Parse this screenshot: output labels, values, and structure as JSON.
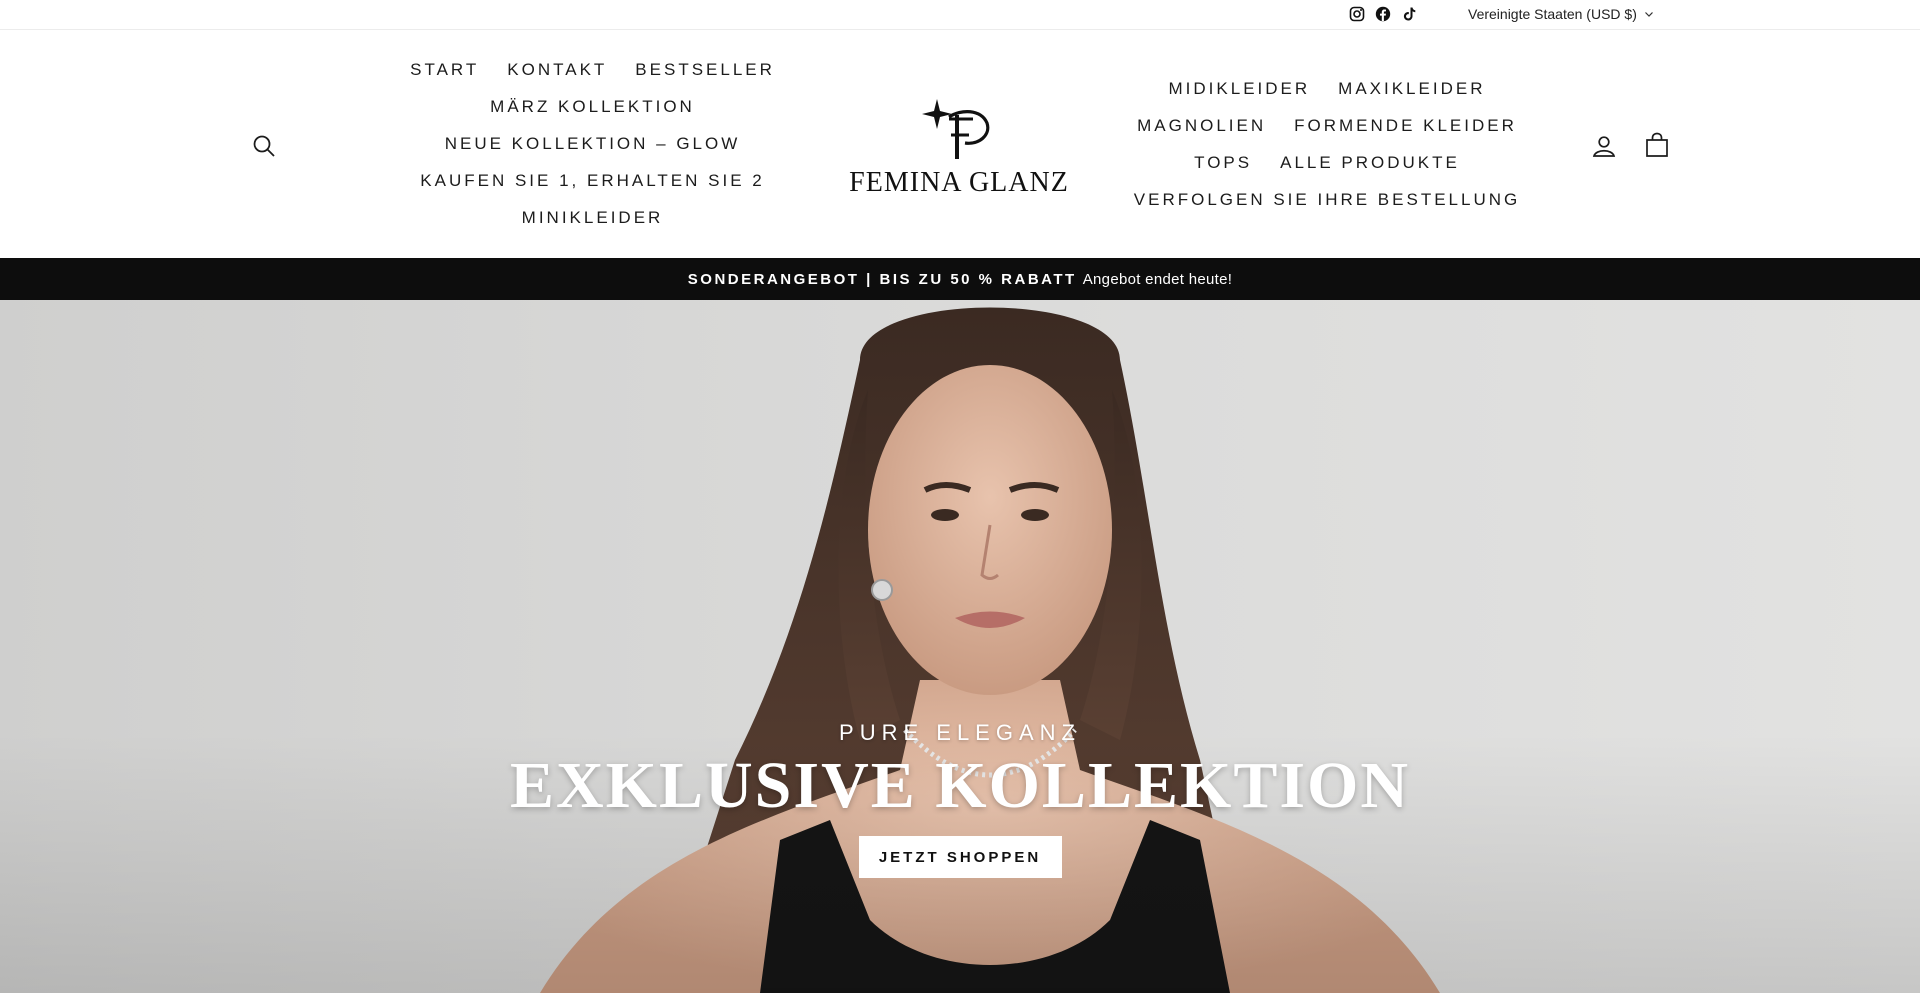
{
  "utility": {
    "social": [
      "instagram-icon",
      "facebook-icon",
      "tiktok-icon"
    ],
    "currency_label": "Vereinigte Staaten (USD $)"
  },
  "brand": {
    "logo_text": "FEMINA GLANZ"
  },
  "nav_left": {
    "rows": [
      [
        "START",
        "KONTAKT",
        "BESTSELLER"
      ],
      [
        "MÄRZ KOLLEKTION"
      ],
      [
        "NEUE KOLLEKTION – GLOW"
      ],
      [
        "KAUFEN SIE 1, ERHALTEN SIE 2"
      ],
      [
        "MINIKLEIDER"
      ]
    ]
  },
  "nav_right": {
    "rows": [
      [
        "MIDIKLEIDER",
        "MAXIKLEIDER"
      ],
      [
        "MAGNOLIEN",
        "FORMENDE KLEIDER"
      ],
      [
        "TOPS",
        "ALLE PRODUKTE"
      ],
      [
        "VERFOLGEN SIE IHRE BESTELLUNG"
      ]
    ]
  },
  "header_icons": {
    "search": "search-icon",
    "account": "account-icon",
    "cart": "cart-icon"
  },
  "announcement": {
    "strong": "SONDERANGEBOT | BIS ZU 50 % RABATT",
    "soft": "Angebot endet heute!"
  },
  "hero": {
    "kicker": "PURE ELEGANZ",
    "title": "EXKLUSIVE KOLLEKTION",
    "button_label": "JETZT SHOPPEN"
  },
  "colors": {
    "announcement_bg": "#0d0d0d",
    "hero_bg": "#d6d6d5",
    "button_bg": "#ffffff"
  }
}
